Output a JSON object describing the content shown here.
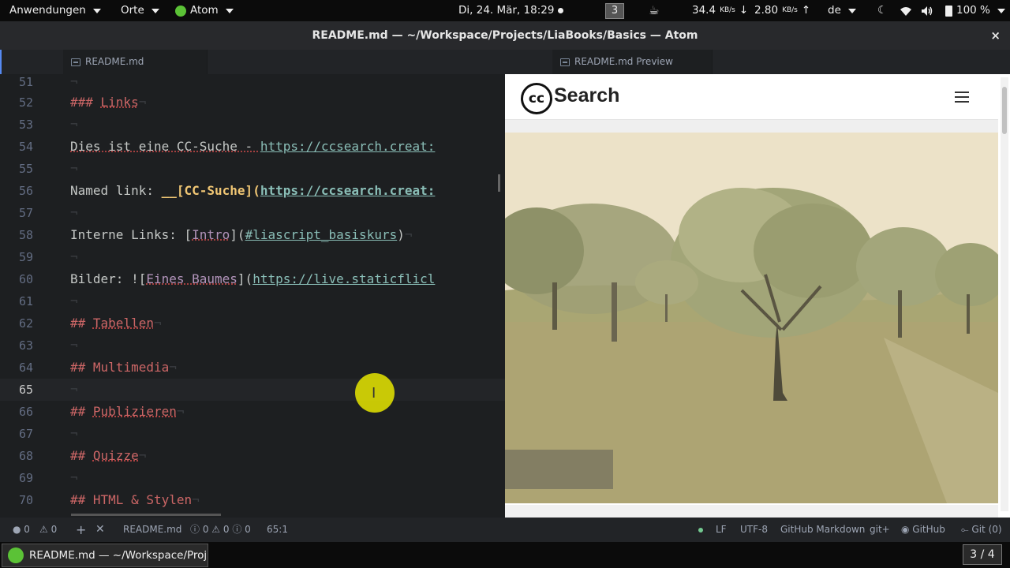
{
  "topbar": {
    "applications": "Anwendungen",
    "places": "Orte",
    "app": "Atom",
    "clock": "Di, 24. Mär, 18:29",
    "workspace": "3",
    "net_down": "34.4",
    "net_down_unit": "KB/s",
    "net_up": "2.80",
    "net_up_unit": "KB/s",
    "language": "de",
    "battery": "100 %"
  },
  "window": {
    "title": "README.md — ~/Workspace/Projects/LiaBooks/Basics — Atom",
    "close": "×"
  },
  "tabs": {
    "editor_tab": "README.md",
    "preview_tab": "README.md Preview"
  },
  "editor": {
    "lines": [
      {
        "n": "51"
      },
      {
        "n": "52",
        "a": "### ",
        "b": "Links"
      },
      {
        "n": "53"
      },
      {
        "n": "54",
        "a": "Dies ist eine CC-Suche - ",
        "url": "https://ccsearch.creat:"
      },
      {
        "n": "55"
      },
      {
        "n": "56",
        "a": "Named link: ",
        "b": "__[CC-Suche](",
        "url": "https://ccsearch.creat:"
      },
      {
        "n": "57"
      },
      {
        "n": "58",
        "a": "Interne Links: [",
        "b": "Intro",
        "c": "](",
        "url": "#liascript_basiskurs",
        "d": ")"
      },
      {
        "n": "59"
      },
      {
        "n": "60",
        "a": "Bilder: ![",
        "b": "Eines Baumes",
        "c": "](",
        "url": "https://live.staticflicl"
      },
      {
        "n": "61"
      },
      {
        "n": "62",
        "a": "## ",
        "b": "Tabellen"
      },
      {
        "n": "63"
      },
      {
        "n": "64",
        "a": "## ",
        "b": "Multimedia"
      },
      {
        "n": "65"
      },
      {
        "n": "66",
        "a": "## ",
        "b": "Publizieren"
      },
      {
        "n": "67"
      },
      {
        "n": "68",
        "a": "## ",
        "b": "Quizze"
      },
      {
        "n": "69"
      },
      {
        "n": "70",
        "a": "## ",
        "b": "HTML & Stylen"
      }
    ]
  },
  "preview": {
    "logo_text": "cc",
    "brand": "Search"
  },
  "status": {
    "errors": "0",
    "warnings": "0",
    "file": "README.md",
    "linter_info": "0",
    "linter_warn": "0",
    "linter_err": "0",
    "cursor_pos": "65:1",
    "line_ending": "LF",
    "encoding": "UTF-8",
    "grammar": "GitHub Markdown",
    "git": "git+",
    "github": "GitHub",
    "git_count": "Git (0)"
  },
  "taskbar": {
    "task_label": "README.md — ~/Workspace/Proj...",
    "workspace_count": "3 / 4"
  },
  "colors": {
    "heading": "#cc6666",
    "url": "#8abeb7",
    "bold": "#f0c674",
    "accent": "#568af2"
  }
}
